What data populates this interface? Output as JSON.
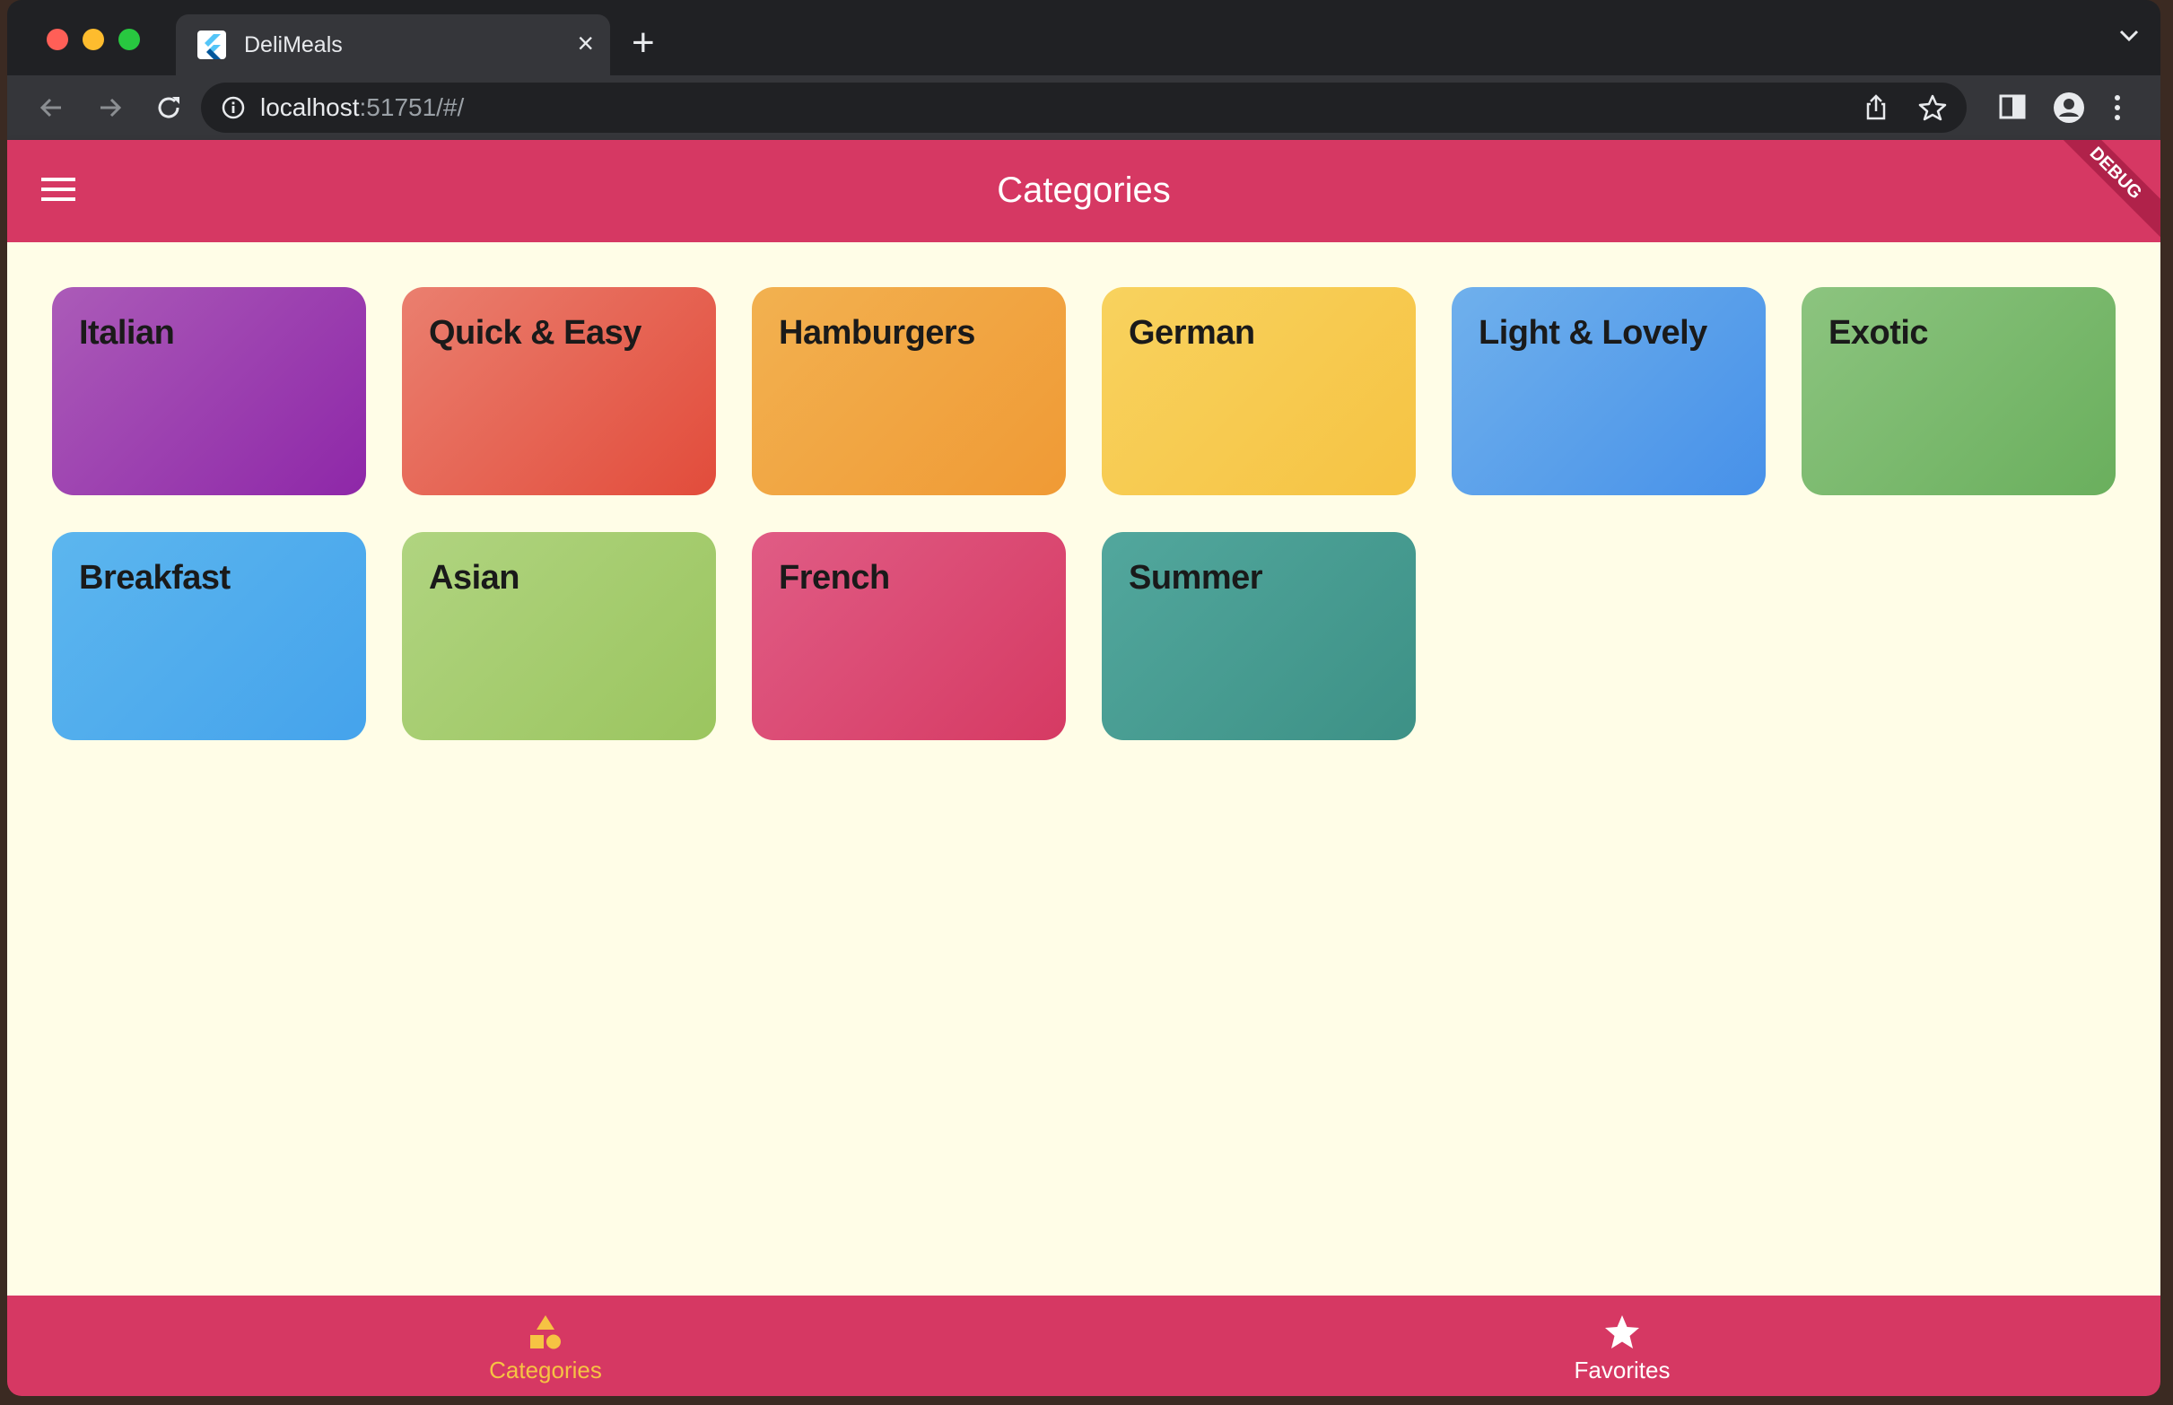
{
  "browser": {
    "tab_title": "DeliMeals",
    "url_host": "localhost",
    "url_rest": ":51751/#/"
  },
  "appbar": {
    "title": "Categories",
    "debug_banner": "DEBUG"
  },
  "categories": [
    {
      "title": "Italian",
      "color_from": "#ab5bb8",
      "color_to": "#8e27a8"
    },
    {
      "title": "Quick & Easy",
      "color_from": "#ea7f6f",
      "color_to": "#e24c3b"
    },
    {
      "title": "Hamburgers",
      "color_from": "#f2b150",
      "color_to": "#f09a35"
    },
    {
      "title": "German",
      "color_from": "#f8d25e",
      "color_to": "#f6c343"
    },
    {
      "title": "Light & Lovely",
      "color_from": "#6fb0ec",
      "color_to": "#4791e9"
    },
    {
      "title": "Exotic",
      "color_from": "#8cc47f",
      "color_to": "#6aaf5d"
    },
    {
      "title": "Breakfast",
      "color_from": "#5cb6ee",
      "color_to": "#45a3ec"
    },
    {
      "title": "Asian",
      "color_from": "#b0d480",
      "color_to": "#9bc55f"
    },
    {
      "title": "French",
      "color_from": "#e05c85",
      "color_to": "#d63a63"
    },
    {
      "title": "Summer",
      "color_from": "#52a79d",
      "color_to": "#3d9186"
    }
  ],
  "bottom_nav": {
    "items": [
      {
        "label": "Categories",
        "icon": "category-icon",
        "active": true
      },
      {
        "label": "Favorites",
        "icon": "star-icon",
        "active": false
      }
    ],
    "active_color": "#f6c343",
    "inactive_color": "#ffffff"
  },
  "colors": {
    "primary": "#d63863",
    "background": "#fffde7"
  }
}
